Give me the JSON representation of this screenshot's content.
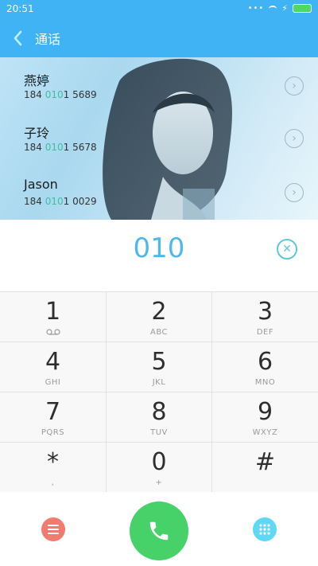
{
  "status_bar": {
    "time": "20:51",
    "dots": "•••",
    "icons": [
      "signal-dots-icon",
      "wifi-icon",
      "charging-icon",
      "battery-icon"
    ],
    "battery_color": "#4cd964"
  },
  "header": {
    "title": "通话",
    "back_icon": "chevron-left-icon",
    "background": "#3fb3f3"
  },
  "contacts": [
    {
      "name": "燕婷",
      "number_prefix": "184 ",
      "number_match": "010",
      "number_suffix": "1 5689"
    },
    {
      "name": "子玲",
      "number_prefix": "184 ",
      "number_match": "010",
      "number_suffix": "1 5678"
    },
    {
      "name": "Jason",
      "number_prefix": "184 ",
      "number_match": "010",
      "number_suffix": "1 0029"
    }
  ],
  "dial_input": {
    "value": "010",
    "clear_icon": "clear-icon"
  },
  "keypad": {
    "keys": [
      {
        "digit": "1",
        "sub": "voicemail-icon"
      },
      {
        "digit": "2",
        "sub": "ABC"
      },
      {
        "digit": "3",
        "sub": "DEF"
      },
      {
        "digit": "4",
        "sub": "GHI"
      },
      {
        "digit": "5",
        "sub": "JKL"
      },
      {
        "digit": "6",
        "sub": "MNO"
      },
      {
        "digit": "7",
        "sub": "PQRS"
      },
      {
        "digit": "8",
        "sub": "TUV"
      },
      {
        "digit": "9",
        "sub": "WXYZ"
      },
      {
        "digit": "*",
        "sub": ","
      },
      {
        "digit": "0",
        "sub": "+"
      },
      {
        "digit": "#",
        "sub": ""
      }
    ]
  },
  "bottom_bar": {
    "menu_icon": "menu-icon",
    "call_icon": "phone-icon",
    "dialpad_icon": "dialpad-grid-icon",
    "colors": {
      "menu": "#f07c6f",
      "call": "#46d268",
      "dialpad": "#5ed8f5"
    }
  }
}
